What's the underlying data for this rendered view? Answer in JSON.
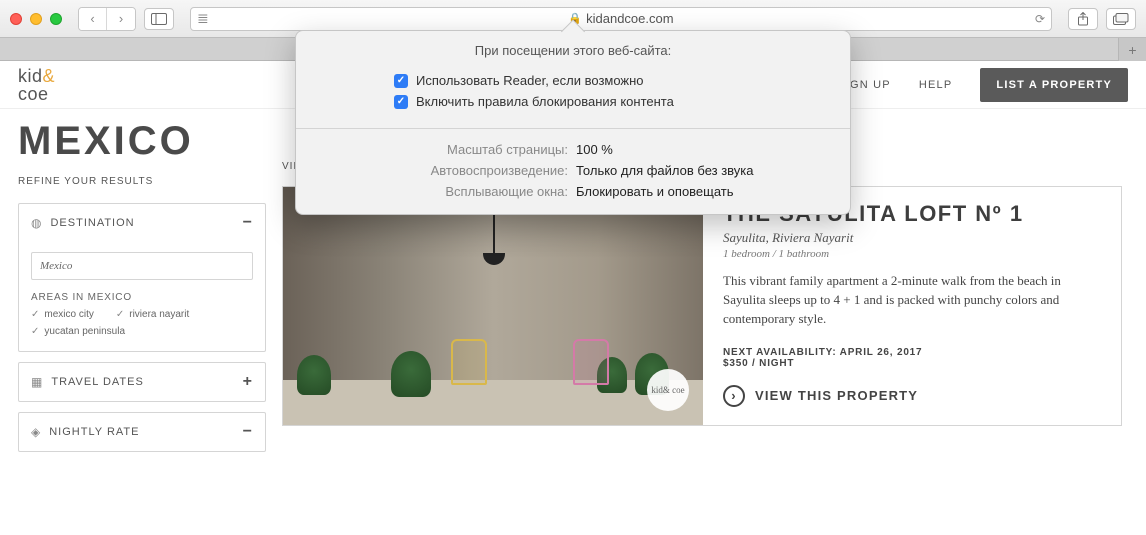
{
  "browser": {
    "url": "kidandcoe.com"
  },
  "popover": {
    "title": "При посещении этого веб-сайта:",
    "opt_reader": "Использовать Reader, если возможно",
    "opt_block": "Включить правила блокирования контента",
    "zoom_label": "Масштаб страницы:",
    "zoom_value": "100 %",
    "autoplay_label": "Автовоспроизведение:",
    "autoplay_value": "Только для файлов без звука",
    "popup_label": "Всплывающие окна:",
    "popup_value": "Блокировать и оповещать"
  },
  "header": {
    "logo_a": "kid",
    "logo_amp": "&",
    "logo_b": "coe",
    "signup": "SIGN UP",
    "help": "HELP",
    "list_btn": "LIST A PROPERTY"
  },
  "page": {
    "title": "MEXICO",
    "refine": "REFINE YOUR RESULTS",
    "view": "VIEW:"
  },
  "filters": {
    "destination": {
      "label": "DESTINATION",
      "input_value": "Mexico",
      "areas_label": "AREAS IN MEXICO",
      "areas": [
        "mexico city",
        "riviera nayarit",
        "yucatan peninsula"
      ]
    },
    "travel_dates": {
      "label": "TRAVEL DATES"
    },
    "nightly_rate": {
      "label": "NIGHTLY RATE"
    }
  },
  "listing": {
    "title": "THE SAYULITA LOFT Nº 1",
    "location": "Sayulita, Riviera Nayarit",
    "meta": "1 bedroom / 1 bathroom",
    "desc": "This vibrant family apartment a 2-minute walk from the beach in Sayulita sleeps up to 4 + 1 and is packed with punchy colors and contemporary style.",
    "availability": "NEXT AVAILABILITY: APRIL 26, 2017",
    "price": "$350 / NIGHT",
    "view": "VIEW THIS PROPERTY",
    "badge": "kid& coe"
  }
}
